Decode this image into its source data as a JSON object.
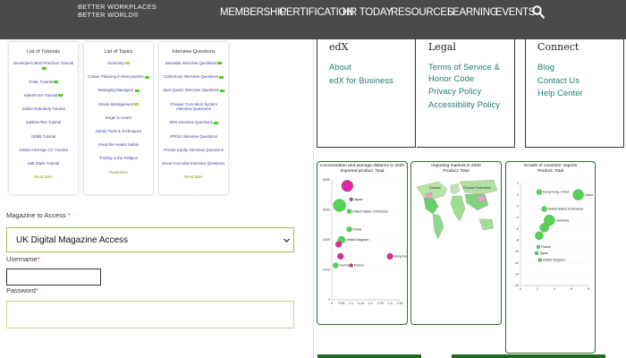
{
  "brand": {
    "line1": "BETTER WORKPLACES",
    "line2": "BETTER WORLD®"
  },
  "nav": {
    "items": [
      "MEMBERSHIP",
      "CERTIFICATION",
      "HR TODAY",
      "RESOURCES",
      "LEARNING",
      "EVENTS"
    ],
    "search_icon": "search-icon"
  },
  "cards": [
    {
      "title": "List of Tutorials",
      "items": [
        {
          "label": "Developers Best Practices Tutorial",
          "tag": "green"
        },
        {
          "label": "YAML Tutorial",
          "tag": "green"
        },
        {
          "label": "SalesForce Tutorial",
          "tag": "green"
        },
        {
          "label": "Adobe Robohelp Tutorial",
          "tag": ""
        },
        {
          "label": "SublimeText Tutorial",
          "tag": ""
        },
        {
          "label": "GitBlit Tutorial",
          "tag": ""
        },
        {
          "label": "Adobe InDesign CC Tutorial",
          "tag": ""
        },
        {
          "label": "Salt Stack Tutorial",
          "tag": ""
        }
      ],
      "more": "Read More"
    },
    {
      "title": "List of Topics",
      "items": [
        {
          "label": "Summary",
          "tag": "yellow"
        },
        {
          "label": "Career Planning in best practice",
          "tag": "green"
        },
        {
          "label": "Managing Managers",
          "tag": "green"
        },
        {
          "label": "Stress Management",
          "tag": "yellow"
        },
        {
          "label": "Eager to Learn",
          "tag": ""
        },
        {
          "label": "Handy Tools & Techniques",
          "tag": ""
        },
        {
          "label": "Keep the Assets Safely",
          "tag": ""
        },
        {
          "label": "Trading is the Religion",
          "tag": ""
        }
      ],
      "more": "Read More"
    },
    {
      "title": "Interview Questions",
      "items": [
        {
          "label": "Bearable Interview Questions",
          "tag": "green"
        },
        {
          "label": "Collections Interview Questions",
          "tag": "green"
        },
        {
          "label": "Java Quartz Interview Questions",
          "tag": "green"
        },
        {
          "label": "Cheque Truncation System Interview Questions",
          "tag": ""
        },
        {
          "label": "SDS Interview Questions",
          "tag": "green"
        },
        {
          "label": "IPRSS Interview Questions",
          "tag": ""
        },
        {
          "label": "Private Equity Interview Questions",
          "tag": ""
        },
        {
          "label": "Excel Formulas Interview Questions",
          "tag": ""
        }
      ],
      "more": "Read More"
    }
  ],
  "form": {
    "magazine_label": "Magazine to Access",
    "magazine_value": "UK Digital Magazine Access",
    "username_label": "Username",
    "password_label": "Password",
    "required_mark": "*"
  },
  "footer": {
    "edx": {
      "title": "edX",
      "links": [
        "About",
        "edX for Business"
      ]
    },
    "legal": {
      "title": "Legal",
      "links": [
        "Terms of Service &",
        "Honor Code",
        "Privacy Policy",
        "Accessibility Policy"
      ]
    },
    "connect": {
      "title": "Connect",
      "links": [
        "Blog",
        "Contact Us",
        "Help Center"
      ]
    }
  },
  "colors": {
    "accent": "#9bc44c",
    "link": "#1d7a6f",
    "green": "#44cc44",
    "magenta": "#e0109a"
  },
  "chart_data": [
    {
      "type": "scatter",
      "title": "Concentration and average distance in 2020",
      "subtitle": "Imported product: Total",
      "x_ticks": [
        "0",
        "0.05",
        "0.1",
        "0.15",
        "0.2",
        "0.25",
        "0.3",
        "0.35"
      ],
      "y_ticks": [
        "0",
        "2000",
        "4000",
        "6000",
        "8000"
      ],
      "xlim": [
        0,
        0.35
      ],
      "ylim": [
        0,
        8000
      ],
      "points": [
        {
          "label": "",
          "x": 0.04,
          "y": 6300,
          "r": 7,
          "color": "#44cc44"
        },
        {
          "label": "",
          "x": 0.08,
          "y": 7600,
          "r": 6.5,
          "color": "#e0109a"
        },
        {
          "label": "Japan",
          "x": 0.1,
          "y": 6700,
          "r": 2,
          "color": "#e0109a"
        },
        {
          "label": "United States of America",
          "x": 0.09,
          "y": 5900,
          "r": 2.5,
          "color": "#44cc44"
        },
        {
          "label": "China",
          "x": 0.09,
          "y": 4700,
          "r": 3,
          "color": "#44cc44"
        },
        {
          "label": "United Kingdom",
          "x": 0.05,
          "y": 4000,
          "r": 4,
          "color": "#44cc44"
        },
        {
          "label": "",
          "x": 0.035,
          "y": 3700,
          "r": 3.5,
          "color": "#e0109a"
        },
        {
          "label": "",
          "x": 0.045,
          "y": 2900,
          "r": 3.5,
          "color": "#e0109a"
        },
        {
          "label": "Hong Kong, China",
          "x": 0.3,
          "y": 2900,
          "r": 3.5,
          "color": "#e0109a"
        },
        {
          "label": "Germany",
          "x": 0.02,
          "y": 2300,
          "r": 3,
          "color": "#44cc44"
        },
        {
          "label": "France",
          "x": 0.1,
          "y": 2300,
          "r": 2,
          "color": "#e0109a"
        }
      ]
    },
    {
      "type": "map",
      "title": "Importing markets in 2020",
      "subtitle": "Product: Total",
      "labels": [
        "Russian Federation",
        "Canada",
        "United States of America",
        "China",
        "Brazil",
        "Australia"
      ]
    },
    {
      "type": "scatter",
      "title": "Growth of countries' imports",
      "subtitle": "Product: Total",
      "x_ticks": [
        "0",
        "2",
        "4",
        "6",
        "8"
      ],
      "y_ticks": [
        "2",
        "0",
        "-2",
        "-4",
        "-6",
        "-8",
        "-10",
        "-12",
        "-14",
        "-16"
      ],
      "xlim": [
        0,
        8
      ],
      "ylim": [
        -16,
        2
      ],
      "points": [
        {
          "label": "Hong Kong, China",
          "x": 2.2,
          "y": 0.5,
          "r": 3,
          "color": "#44cc44"
        },
        {
          "label": "China",
          "x": 6.8,
          "y": 0,
          "r": 6,
          "color": "#44cc44"
        },
        {
          "label": "United States of America",
          "x": 2.8,
          "y": -2.5,
          "r": 3,
          "color": "#44cc44"
        },
        {
          "label": "Germany",
          "x": 3.4,
          "y": -4.5,
          "r": 6,
          "color": "#44cc44"
        },
        {
          "label": "",
          "x": 2.8,
          "y": -5.8,
          "r": 5,
          "color": "#44cc44"
        },
        {
          "label": "",
          "x": 2.2,
          "y": -7.2,
          "r": 4.5,
          "color": "#44cc44"
        },
        {
          "label": "France",
          "x": 2.1,
          "y": -9.2,
          "r": 2,
          "color": "#44cc44"
        },
        {
          "label": "Japan",
          "x": 1.9,
          "y": -10.3,
          "r": 2,
          "color": "#44cc44"
        },
        {
          "label": "United Kingdom",
          "x": 2.3,
          "y": -11.5,
          "r": 2,
          "color": "#44cc44"
        }
      ]
    }
  ]
}
